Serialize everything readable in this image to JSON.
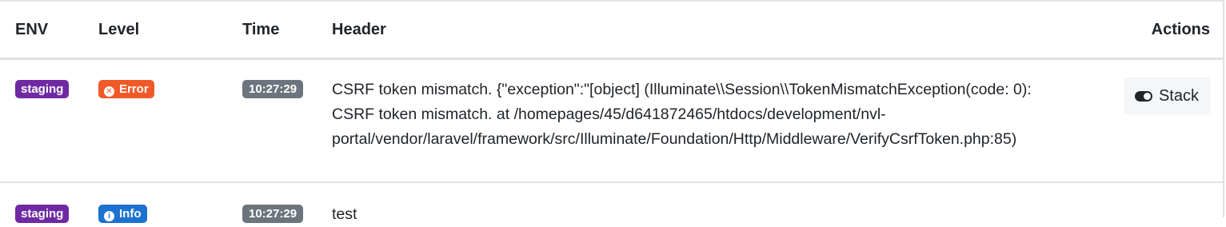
{
  "table": {
    "headers": {
      "env": "ENV",
      "level": "Level",
      "time": "Time",
      "header": "Header",
      "actions": "Actions"
    },
    "rows": [
      {
        "env": "staging",
        "level": "Error",
        "level_icon": "times-circle-icon",
        "time": "10:27:29",
        "header": "CSRF token mismatch. {\"exception\":\"[object] (Illuminate\\\\Session\\\\TokenMismatchException(code: 0): CSRF token mismatch. at /homepages/45/d641872465/htdocs/development/nvl-portal/vendor/laravel/framework/src/Illuminate/Foundation/Http/Middleware/VerifyCsrfToken.php:85)",
        "action_label": "Stack",
        "action_icon": "toggle-on-icon"
      },
      {
        "env": "staging",
        "level": "Info",
        "level_icon": "info-circle-icon",
        "time": "10:27:29",
        "header": "test"
      }
    ]
  },
  "colors": {
    "env_badge": "#6f2aa3",
    "error_badge": "#f05a28",
    "info_badge": "#1d72d0",
    "time_badge": "#6c757d"
  }
}
